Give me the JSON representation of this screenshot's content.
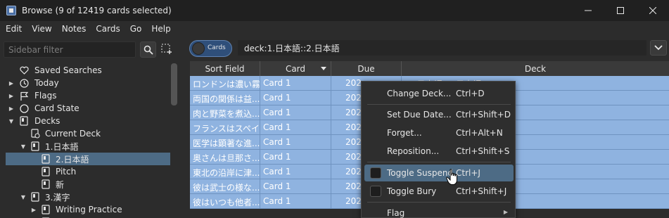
{
  "window": {
    "title": "Browse (9 of 12419 cards selected)",
    "controls": [
      "minimize",
      "maximize",
      "close"
    ]
  },
  "menubar": [
    "Edit",
    "View",
    "Notes",
    "Cards",
    "Go",
    "Help"
  ],
  "sidebar": {
    "filter_placeholder": "Sidebar filter",
    "items": [
      {
        "label": "Saved Searches",
        "icon": "heart-icon",
        "level": 0,
        "arrow": ""
      },
      {
        "label": "Today",
        "icon": "clock-icon",
        "level": 0,
        "arrow": "collapsed"
      },
      {
        "label": "Flags",
        "icon": "flag-icon",
        "level": 0,
        "arrow": "collapsed"
      },
      {
        "label": "Card State",
        "icon": "circle-icon",
        "level": 0,
        "arrow": "collapsed"
      },
      {
        "label": "Decks",
        "icon": "deck-icon",
        "level": 0,
        "arrow": "expanded"
      },
      {
        "label": "Current Deck",
        "icon": "current-deck-icon",
        "level": 1,
        "arrow": ""
      },
      {
        "label": "1.日本語",
        "icon": "deck-icon",
        "level": 1,
        "arrow": "expanded"
      },
      {
        "label": "2.日本語",
        "icon": "deck-icon",
        "level": 2,
        "arrow": "",
        "selected": true
      },
      {
        "label": "Pitch",
        "icon": "deck-icon",
        "level": 2,
        "arrow": ""
      },
      {
        "label": "新",
        "icon": "deck-icon",
        "level": 2,
        "arrow": ""
      },
      {
        "label": "3.漢字",
        "icon": "deck-icon",
        "level": 1,
        "arrow": "expanded"
      },
      {
        "label": "Writing Practice",
        "icon": "deck-icon",
        "level": 2,
        "arrow": "collapsed"
      }
    ]
  },
  "search": {
    "mode_label": "Cards",
    "query": "deck:1.日本語::2.日本語"
  },
  "table": {
    "columns": [
      "Sort Field",
      "Card",
      "Due",
      "Deck"
    ],
    "rows": [
      {
        "sort_field": "ロンドンは濃い霧...",
        "card": "Card 1",
        "due": "202",
        "deck": "1.日本語::2.日本語"
      },
      {
        "sort_field": "両国の関係は益...",
        "card": "Card 1",
        "due": "202",
        "deck": ""
      },
      {
        "sort_field": "肉と野菜を煮込...",
        "card": "Card 1",
        "due": "202",
        "deck": ""
      },
      {
        "sort_field": "フランスはスペイ...",
        "card": "Card 1",
        "due": "202",
        "deck": ""
      },
      {
        "sort_field": "医学は顕著な進...",
        "card": "Card 1",
        "due": "202",
        "deck": ""
      },
      {
        "sort_field": "奥さんは旦那さ...",
        "card": "Card 1",
        "due": "202",
        "deck": ""
      },
      {
        "sort_field": "東北の沿岸に津...",
        "card": "Card 1",
        "due": "202",
        "deck": ""
      },
      {
        "sort_field": "彼は武士の様な...",
        "card": "Card 1",
        "due": "202",
        "deck": ""
      },
      {
        "sort_field": "彼はいつも他者...",
        "card": "Card 1",
        "due": "202",
        "deck": ""
      }
    ]
  },
  "context_menu": {
    "items": [
      {
        "label": "Change Deck...",
        "shortcut": "Ctrl+D"
      },
      {
        "label": "Set Due Date...",
        "shortcut": "Ctrl+Shift+D"
      },
      {
        "label": "Forget...",
        "shortcut": "Ctrl+Alt+N"
      },
      {
        "label": "Reposition...",
        "shortcut": "Ctrl+Shift+S"
      },
      {
        "label": "Toggle Suspend",
        "shortcut": "Ctrl+J",
        "highlighted": true,
        "checkbox": true
      },
      {
        "label": "Toggle Bury",
        "shortcut": "Ctrl+Shift+J",
        "checkbox": true
      },
      {
        "label": "Flag",
        "shortcut": "",
        "submenu": true
      }
    ]
  },
  "colors": {
    "selection_row": "#8fb3e0",
    "highlight": "#4d6b85",
    "background": "#2c2c2c"
  }
}
